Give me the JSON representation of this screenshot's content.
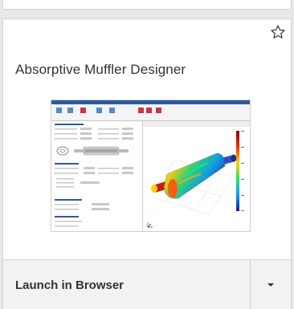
{
  "card": {
    "title": "Absorptive Muffler Designer",
    "launch_label": "Launch in Browser"
  },
  "icons": {
    "favorite": "star-outline-icon",
    "dropdown": "caret-down-icon"
  },
  "colors": {
    "border": "#d4d4d4",
    "footer_bg": "#f2f2f2",
    "text": "#333333"
  }
}
